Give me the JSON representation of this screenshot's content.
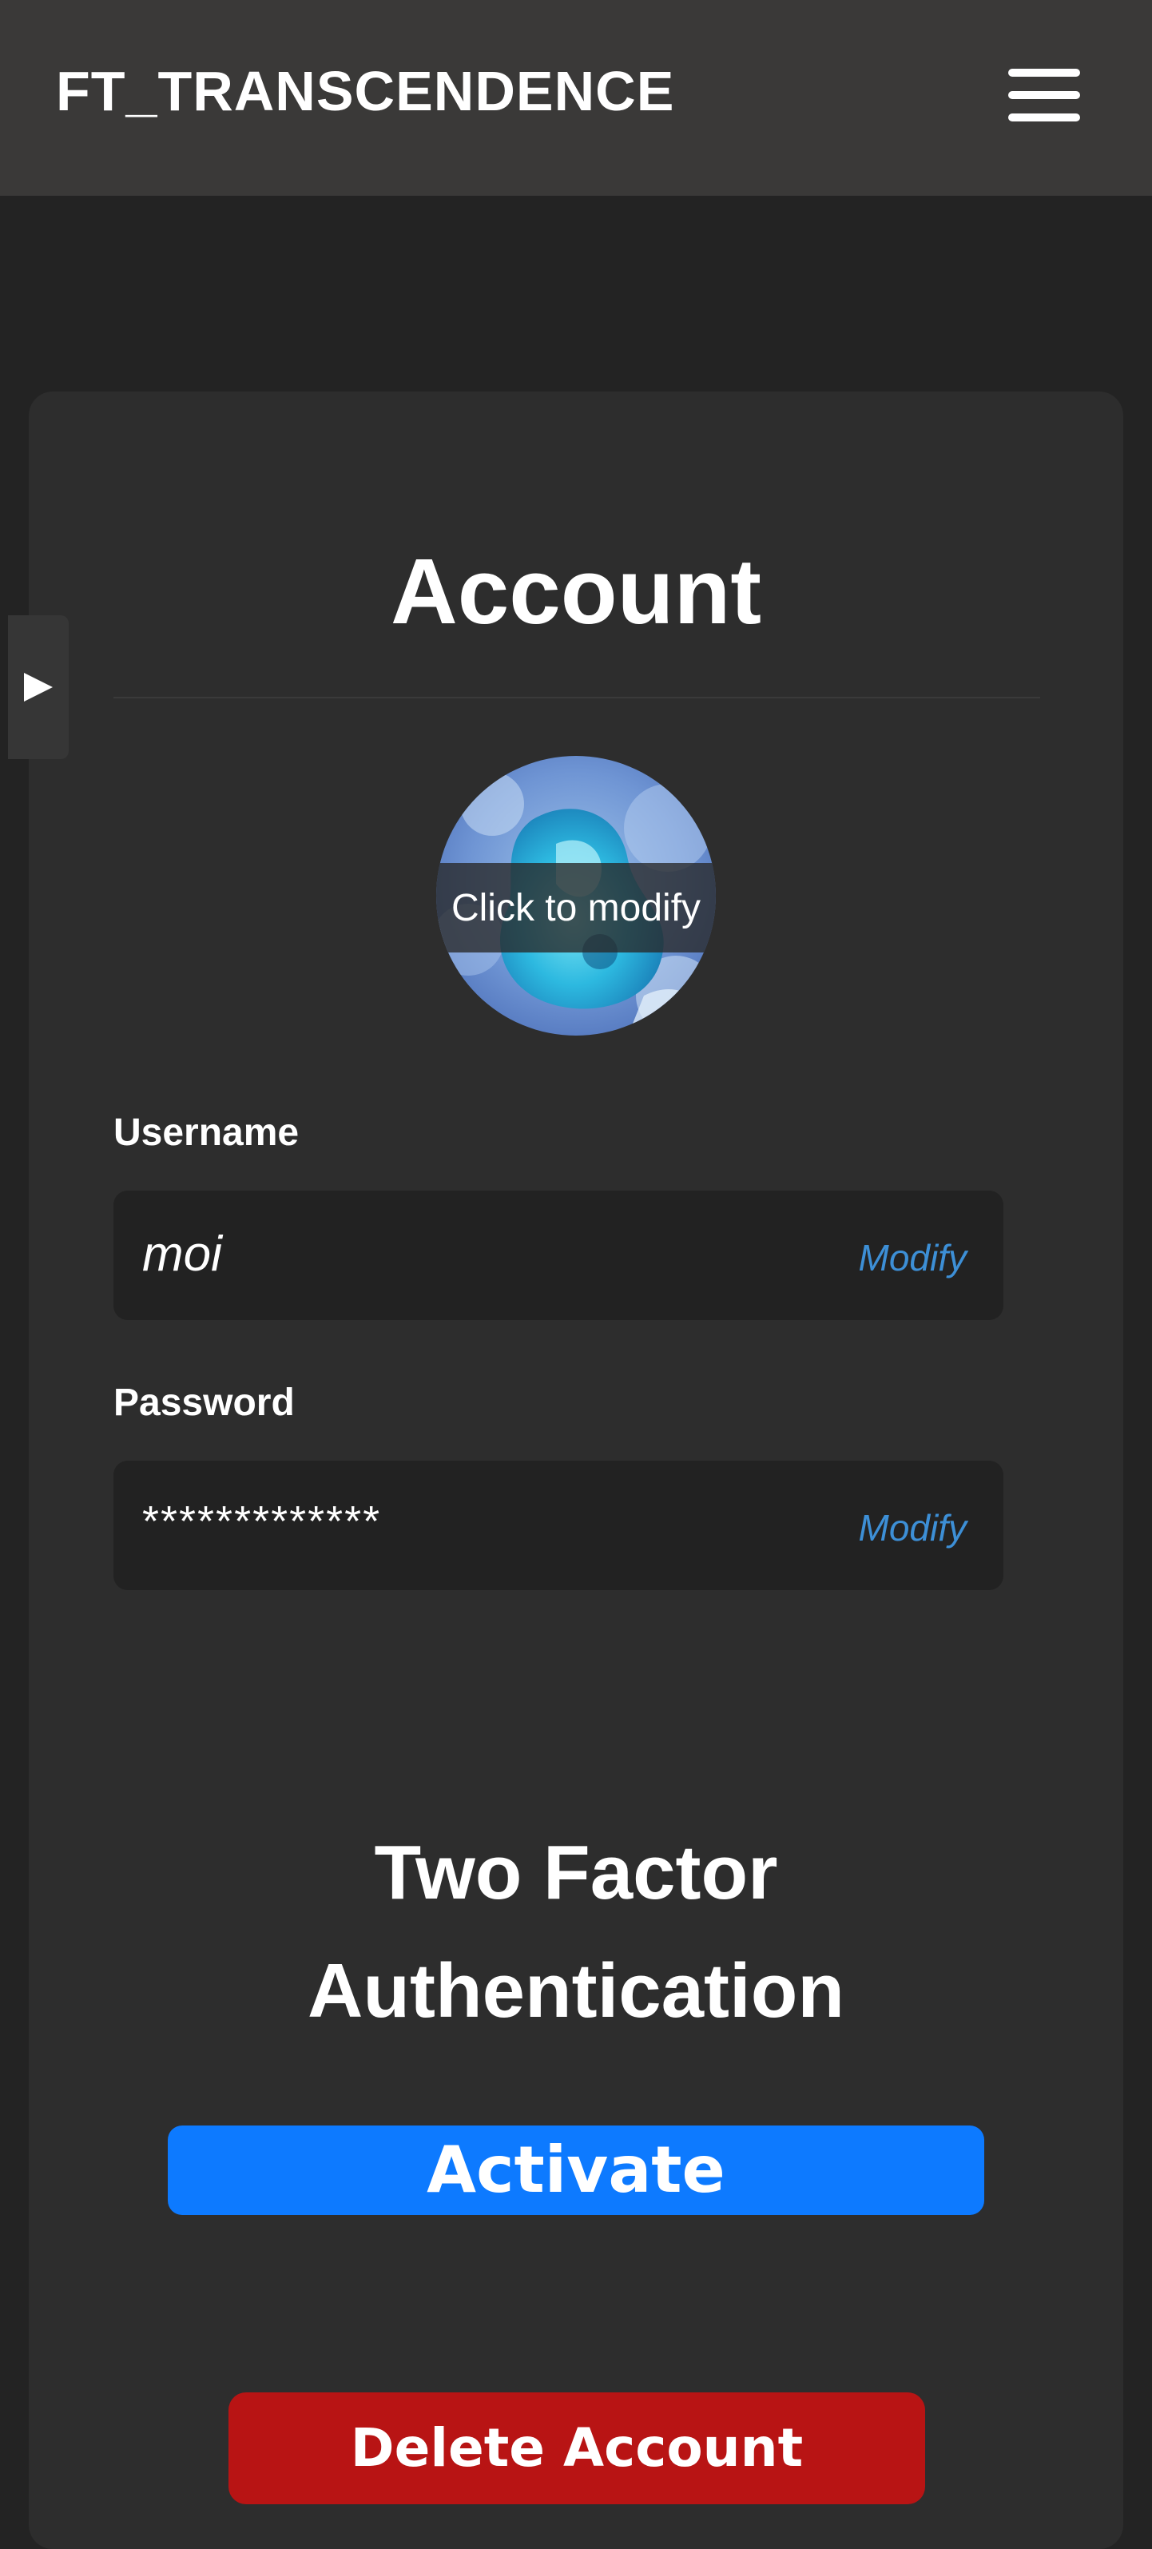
{
  "navbar": {
    "brand": "FT_TRANSCENDENCE",
    "menu_icon": "hamburger-menu-icon"
  },
  "sidebar_toggle": {
    "icon": "play-triangle-icon",
    "glyph": "▶"
  },
  "account": {
    "title": "Account",
    "avatar_overlay": "Click to modify",
    "username_label": "Username",
    "username_value": "moi",
    "username_modify": "Modify",
    "password_label": "Password",
    "password_value": "*************",
    "password_modify": "Modify"
  },
  "two_factor": {
    "title_line1": "Two Factor",
    "title_line2": "Authentication",
    "activate_label": "Activate"
  },
  "danger": {
    "delete_label": "Delete Account"
  },
  "colors": {
    "background": "#232323",
    "navbar": "#3a3938",
    "card": "#2d2d2d",
    "field": "#222222",
    "link": "#3d8fd6",
    "primary": "#0d7aff",
    "danger": "#b81414"
  }
}
